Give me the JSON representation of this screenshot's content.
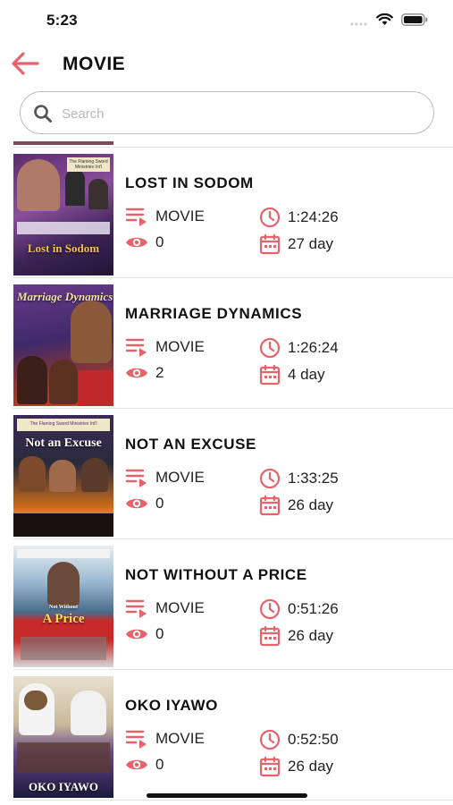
{
  "status_bar": {
    "time": "5:23"
  },
  "header": {
    "title": "MOVIE"
  },
  "search": {
    "placeholder": "Search"
  },
  "colors": {
    "accent": "#e8626a"
  },
  "items": [
    {
      "title": "LOST IN SODOM",
      "category": "MOVIE",
      "duration": "1:24:26",
      "views": "0",
      "age": "27 day",
      "poster_text": "Lost in Sodom",
      "poster_headline": "The Flaming Sword Ministries Int'l"
    },
    {
      "title": "MARRIAGE DYNAMICS",
      "category": "MOVIE",
      "duration": "1:26:24",
      "views": "2",
      "age": "4 day",
      "poster_text": "Marriage Dynamics",
      "poster_headline": ""
    },
    {
      "title": "NOT AN EXCUSE",
      "category": "MOVIE",
      "duration": "1:33:25",
      "views": "0",
      "age": "26 day",
      "poster_text": "Not an Excuse",
      "poster_headline": "The Flaming Sword Ministries Int'l"
    },
    {
      "title": "NOT WITHOUT A PRICE",
      "category": "MOVIE",
      "duration": "0:51:26",
      "views": "0",
      "age": "26 day",
      "poster_text": "A Price",
      "poster_headline": "Not Without"
    },
    {
      "title": "OKO IYAWO",
      "category": "MOVIE",
      "duration": "0:52:50",
      "views": "0",
      "age": "26 day",
      "poster_text": "OKO IYAWO",
      "poster_headline": ""
    }
  ]
}
